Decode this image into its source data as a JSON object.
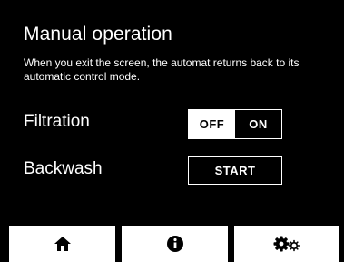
{
  "screen": {
    "title": "Manual operation",
    "note": "When you exit the screen, the automat returns back to its automatic control mode."
  },
  "filtration": {
    "label": "Filtration",
    "off_label": "OFF",
    "on_label": "ON",
    "state": "OFF"
  },
  "backwash": {
    "label": "Backwash",
    "start_label": "START"
  },
  "nav": {
    "items": [
      {
        "icon": "home-icon"
      },
      {
        "icon": "info-icon"
      },
      {
        "icon": "settings-icon"
      }
    ]
  },
  "colors": {
    "background": "#000000",
    "foreground": "#ffffff"
  }
}
